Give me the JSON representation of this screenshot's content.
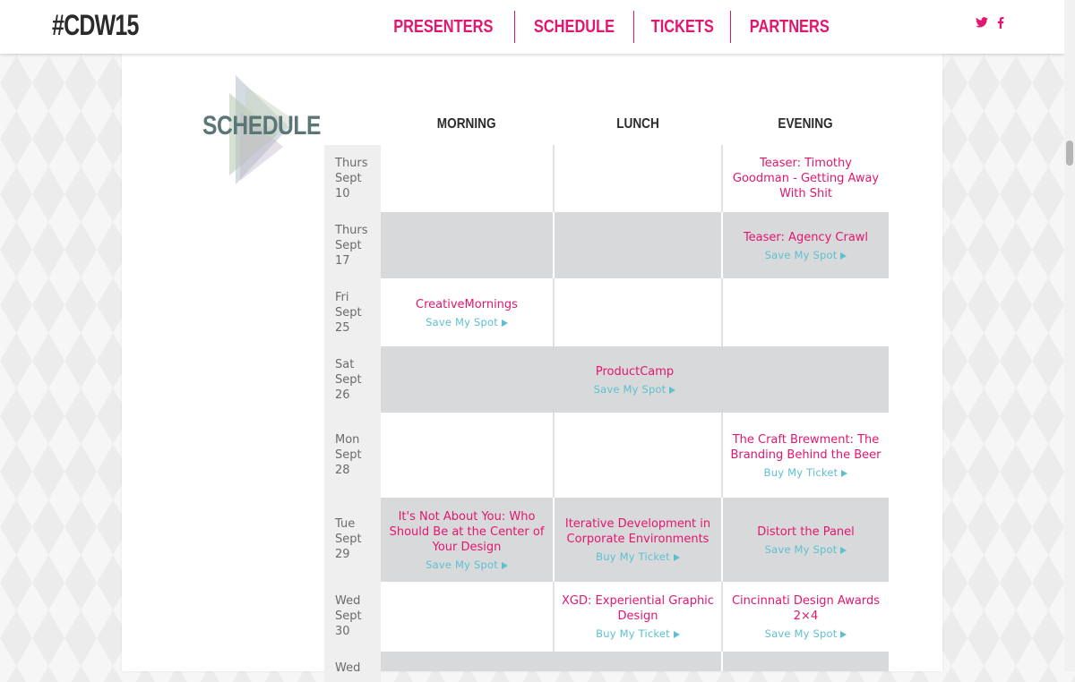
{
  "header": {
    "logo": "#CDW15",
    "nav": [
      "PRESENTERS",
      "SCHEDULE",
      "TICKETS",
      "PARTNERS"
    ],
    "social": {
      "twitter_icon": "twitter-icon",
      "facebook_icon": "facebook-icon"
    }
  },
  "section": {
    "title": "SCHEDULE"
  },
  "columns": {
    "morning": "MORNING",
    "lunch": "LUNCH",
    "evening": "EVENING"
  },
  "days": {
    "d1": {
      "name": "Thurs",
      "month": "Sept",
      "date": "10"
    },
    "d2": {
      "name": "Thurs",
      "month": "Sept",
      "date": "17"
    },
    "d3": {
      "name": "Fri",
      "month": "Sept",
      "date": "25"
    },
    "d4": {
      "name": "Sat",
      "month": "Sept",
      "date": "26"
    },
    "d5": {
      "name": "Mon",
      "month": "Sept",
      "date": "28"
    },
    "d6": {
      "name": "Tue",
      "month": "Sept",
      "date": "29"
    },
    "d7": {
      "name": "Wed",
      "month": "Sept",
      "date": "30"
    },
    "d8": {
      "name": "Wed",
      "month": "",
      "date": ""
    }
  },
  "events": {
    "teaser_goodman": {
      "title": "Teaser: Timothy Goodman - Getting Away With Shit"
    },
    "agency_crawl": {
      "title": "Teaser: Agency Crawl",
      "cta": "Save My Spot"
    },
    "creative_mornings": {
      "title": "CreativeMornings",
      "cta": "Save My Spot"
    },
    "productcamp": {
      "title": "ProductCamp",
      "cta": "Save My Spot"
    },
    "craft_brewment": {
      "title": "The Craft Brewment: The Branding Behind the Beer",
      "cta": "Buy My Ticket"
    },
    "not_about_you": {
      "title": "It's Not About You: Who Should Be at the Center of Your Design",
      "cta": "Save My Spot"
    },
    "iterative_dev": {
      "title": "Iterative Development in Corporate Environments",
      "cta": "Buy My Ticket"
    },
    "distort_panel": {
      "title": "Distort the Panel",
      "cta": "Save My Spot"
    },
    "xgd": {
      "title": "XGD: Experiential Graphic Design",
      "cta": "Buy My Ticket"
    },
    "awards": {
      "title": "Cincinnati Design Awards 2×4",
      "cta": "Save My Spot"
    }
  },
  "colors": {
    "accent": "#e3166f",
    "cta": "#5dc0cf",
    "grey_row": "#d8d9db",
    "title_teal": "#5b7676"
  }
}
